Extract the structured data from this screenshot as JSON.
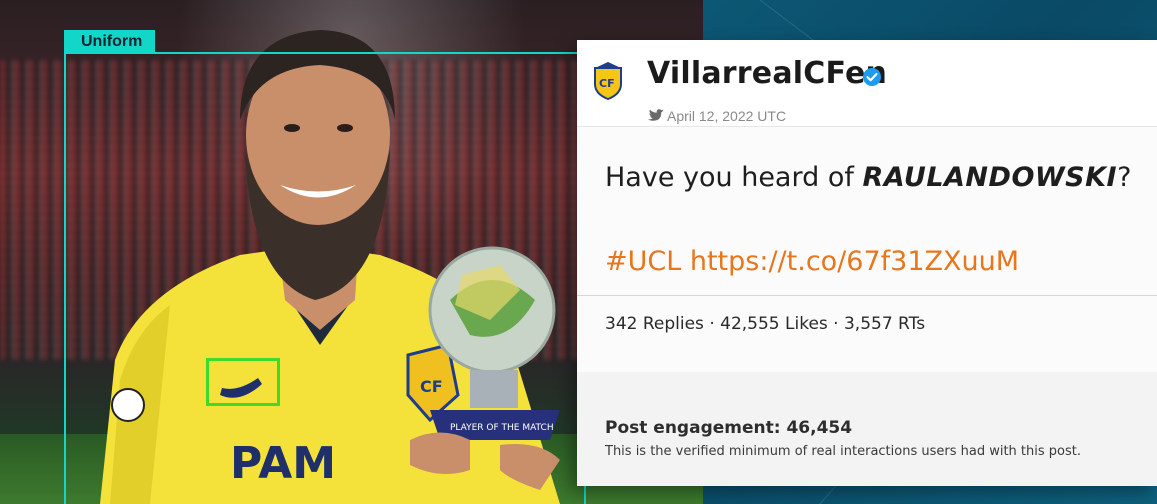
{
  "photo": {
    "uniform_label": "Uniform"
  },
  "tweet": {
    "username": "VillarrealCFen",
    "date": "April 12, 2022 UTC",
    "text_prefix": "Have you heard of ",
    "text_bold": "RAULANDOWSKI",
    "text_suffix": "?",
    "link_line": "#UCL https://t.co/67f31ZXuuM",
    "stats": "342 Replies · 42,555 Likes · 3,557 RTs",
    "engagement_label": "Post engagement: 46,454",
    "engagement_note": "This is the verified minimum of real interactions users had with this post."
  },
  "icons": [
    "villarreal-crest-icon",
    "verified-badge-icon",
    "twitter-bird-icon"
  ],
  "colors": {
    "annotation_cyan": "#12d6c8",
    "annotation_green": "#3cdc28",
    "link_orange": "#e8761d",
    "verified_blue": "#1d9bf0",
    "background_teal": "#0d5c79"
  }
}
